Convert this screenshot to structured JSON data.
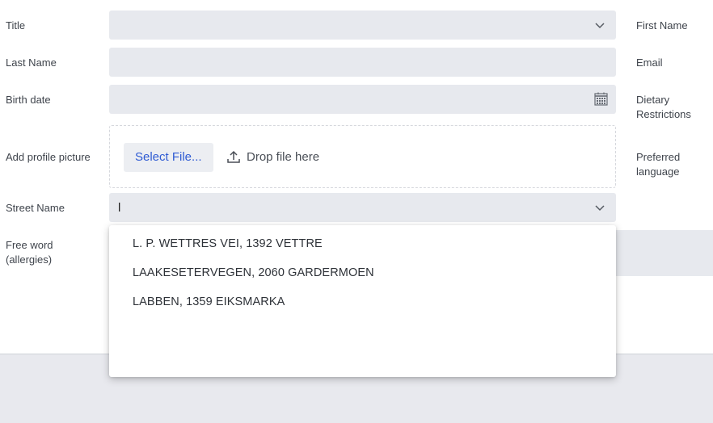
{
  "form": {
    "left_labels": {
      "title": "Title",
      "last_name": "Last Name",
      "birth_date": "Birth date",
      "profile_picture": "Add profile picture",
      "street_name": "Street Name",
      "free_word": "Free word (allergies)"
    },
    "right_labels": {
      "first_name": "First Name",
      "email": "Email",
      "dietary": "Dietary Restrictions",
      "language": "Preferred language"
    },
    "upload": {
      "button_label": "Select File...",
      "drop_hint": "Drop file here"
    },
    "street": {
      "value": "l"
    }
  },
  "autocomplete": {
    "options": [
      "L. P. WETTRES VEI, 1392 VETTRE",
      "LAAKESETERVEGEN, 2060 GARDERMOEN",
      "LABBEN, 1359 EIKSMARKA"
    ]
  },
  "icons": {
    "title_dropdown": "chevron-down-icon",
    "birth_date_picker": "calendar-icon",
    "upload": "upload-icon",
    "street_dropdown": "chevron-down-icon"
  },
  "colors": {
    "field_bg": "#e7e9ee",
    "accent": "#2f5bd3",
    "footer_bg": "#e8e9ee"
  }
}
